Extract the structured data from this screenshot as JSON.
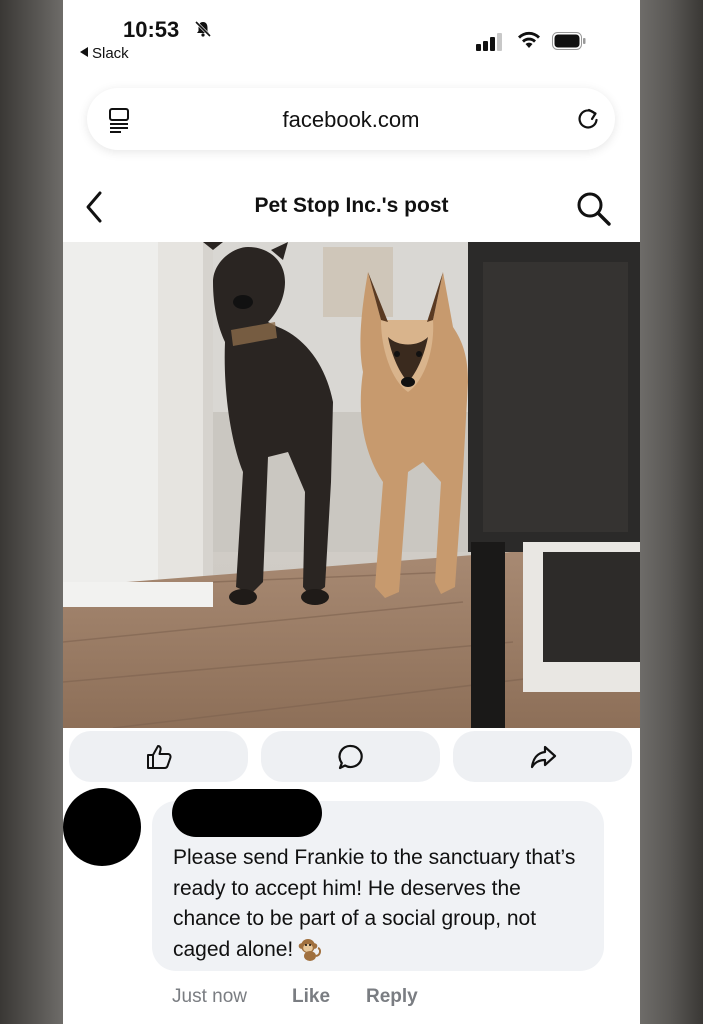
{
  "status_bar": {
    "time": "10:53",
    "back_app": "Slack",
    "icons": [
      "bell-slash-icon",
      "cellular-signal-icon",
      "wifi-icon",
      "battery-icon"
    ]
  },
  "browser": {
    "url": "facebook.com",
    "icons": [
      "tabs-icon",
      "reload-icon"
    ]
  },
  "header": {
    "title": "Pet Stop Inc.'s post",
    "icons": [
      "back-chevron-icon",
      "search-icon"
    ]
  },
  "post": {
    "photo": "two-dogs-in-doorway"
  },
  "actions": {
    "icons": [
      "like-icon",
      "comment-icon",
      "share-icon"
    ]
  },
  "comment": {
    "text": "Please send Frankie to the sanctuary that’s ready to accept him! He deserves the chance to be part of a social group, not caged alone!",
    "emoji": "monkey-emoji",
    "timestamp": "Just now",
    "like_label": "Like",
    "reply_label": "Reply"
  },
  "colors": {
    "bubble": "#f0f2f5",
    "action_button": "#eef0f3",
    "meta_text": "#7a7d82"
  }
}
